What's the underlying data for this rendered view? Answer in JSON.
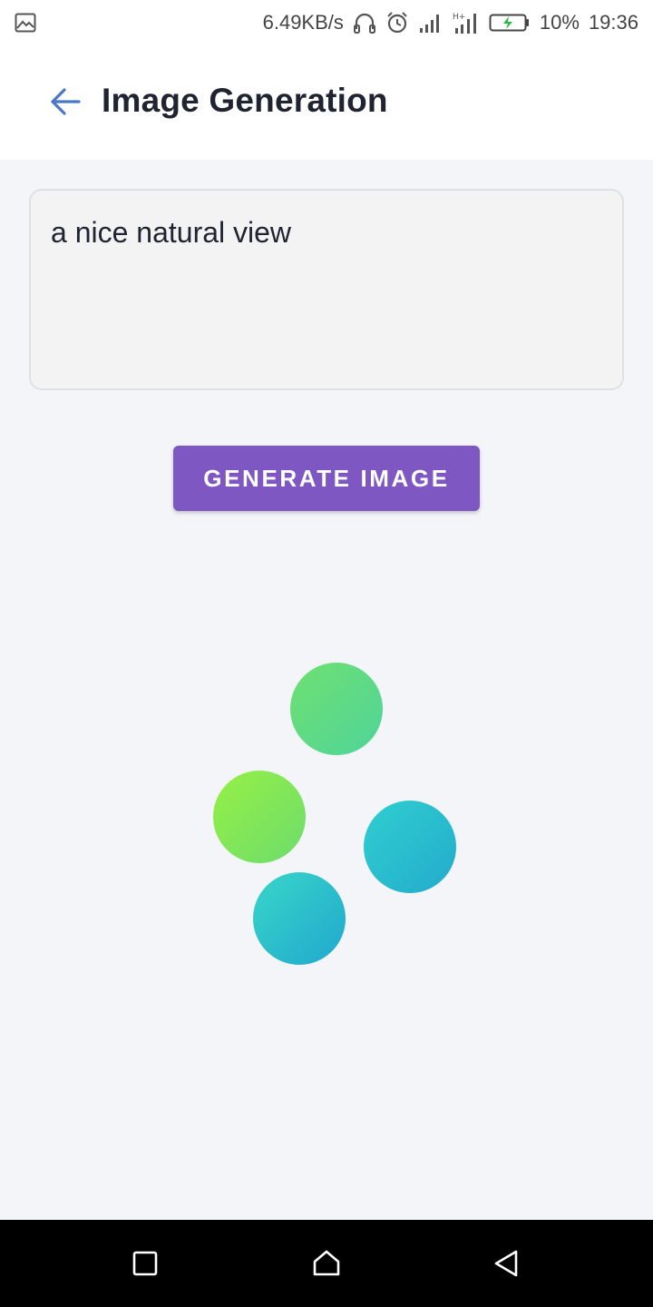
{
  "status_bar": {
    "network_speed": "6.49KB/s",
    "battery_percent": "10%",
    "time": "19:36",
    "icons": [
      "image-icon",
      "headphones-icon",
      "alarm-icon",
      "signal-icon",
      "signal-icon",
      "battery-charging-icon"
    ],
    "battery_level": 0.1
  },
  "app_bar": {
    "title": "Image Generation",
    "back_icon": "arrow-left-icon"
  },
  "prompt": {
    "value": "a nice natural view"
  },
  "generate_button": {
    "label": "GENERATE IMAGE"
  },
  "loader": {
    "dots": 4
  },
  "nav_bar": {
    "buttons": [
      "recents-square-icon",
      "home-icon",
      "back-triangle-icon"
    ]
  },
  "colors": {
    "accent": "#7e57c2",
    "back_arrow": "#4a78c9",
    "background": "#f4f5f9",
    "loader_green": "#6fe070",
    "loader_lime": "#96f045",
    "loader_teal": "#22abcc"
  }
}
